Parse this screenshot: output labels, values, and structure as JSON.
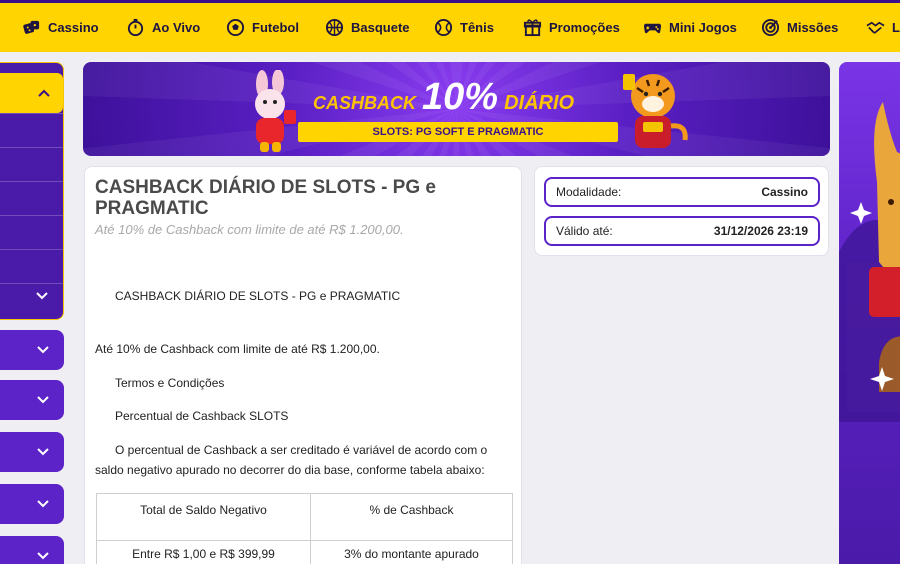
{
  "nav": {
    "items": [
      {
        "label": "Cassino",
        "icon": "dice-icon"
      },
      {
        "label": "Ao Vivo",
        "icon": "stopwatch-icon"
      },
      {
        "label": "Futebol",
        "icon": "soccer-ball-icon"
      },
      {
        "label": "Basquete",
        "icon": "basketball-icon"
      },
      {
        "label": "Tênis",
        "icon": "tennis-ball-icon"
      },
      {
        "label": "Promoções",
        "icon": "gift-icon"
      },
      {
        "label": "Mini Jogos",
        "icon": "gamepad-icon"
      },
      {
        "label": "Missões",
        "icon": "target-icon"
      },
      {
        "label": "Lo",
        "icon": "handshake-icon"
      }
    ]
  },
  "banner": {
    "word1": "CASHBACK",
    "percent": "10%",
    "word2": "DIÁRIO",
    "subtitle": "SLOTS: PG SOFT E PRAGMATIC"
  },
  "promotion": {
    "title": "CASHBACK DIÁRIO DE SLOTS - PG e PRAGMATIC",
    "subtitle": "Até 10% de Cashback com limite de até R$ 1.200,00.",
    "content": {
      "heading": "CASHBACK DIÁRIO DE SLOTS - PG e PRAGMATIC",
      "intro": "Até 10% de Cashback com limite de até R$ 1.200,00.",
      "terms_heading": "Termos e Condições",
      "percent_heading": "Percentual de Cashback SLOTS",
      "paragraph_line1": "O percentual de Cashback a ser creditado é variável de acordo com o",
      "paragraph_line2": "saldo negativo apurado no decorrer do dia base, conforme tabela abaixo:"
    },
    "table": {
      "headers": [
        "Total de Saldo Negativo",
        "% de Cashback"
      ],
      "rows": [
        [
          "Entre R$ 1,00 e R$ 399,99",
          "3% do montante apurado"
        ]
      ]
    }
  },
  "info": {
    "modality_label": "Modalidade:",
    "modality_value": "Cassino",
    "valid_label": "Válido até:",
    "valid_value": "31/12/2026 23:19"
  },
  "colors": {
    "nav_bg": "#ffd400",
    "brand_purple": "#5b23c8",
    "accent_yellow": "#ffc400"
  }
}
